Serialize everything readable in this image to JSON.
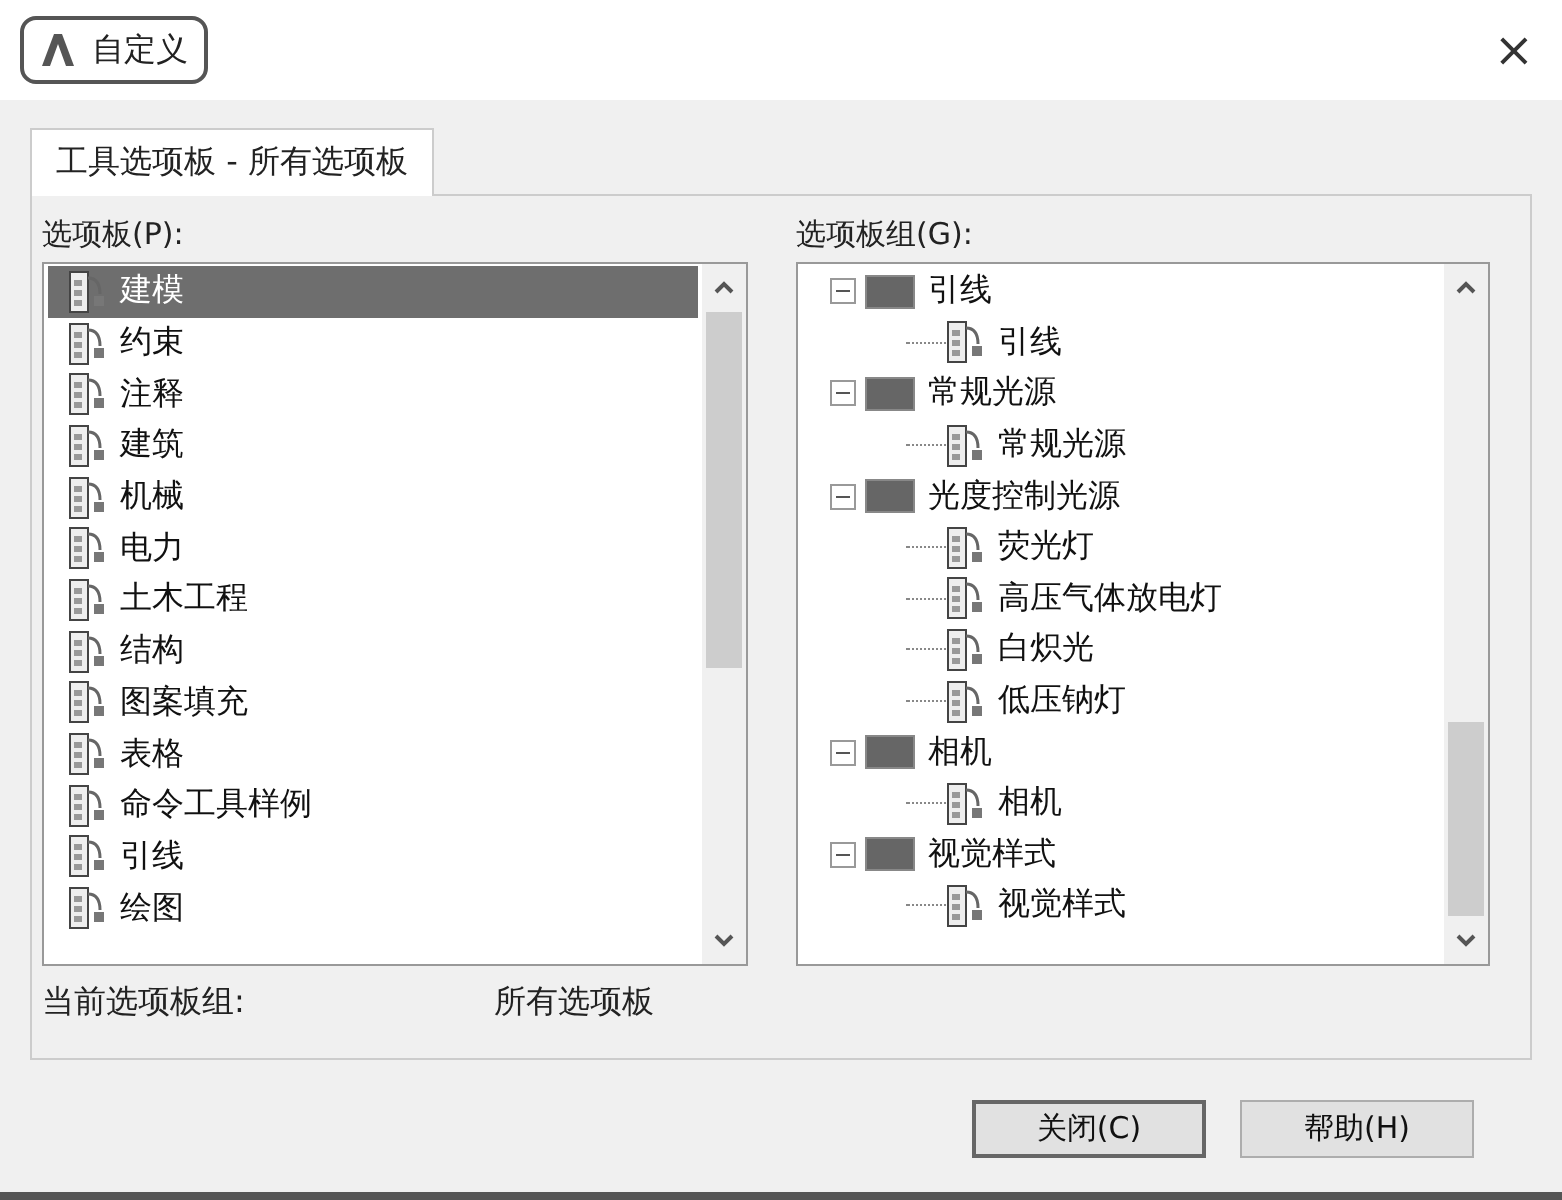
{
  "window": {
    "title": "自定义",
    "close": "×"
  },
  "tabs": [
    {
      "label": "工具选项板 - 所有选项板",
      "selected": true
    }
  ],
  "palettes": {
    "label": "选项板(P):",
    "items": [
      {
        "label": "建模",
        "selected": true
      },
      {
        "label": "约束",
        "selected": false
      },
      {
        "label": "注释",
        "selected": false
      },
      {
        "label": "建筑",
        "selected": false
      },
      {
        "label": "机械",
        "selected": false
      },
      {
        "label": "电力",
        "selected": false
      },
      {
        "label": "土木工程",
        "selected": false
      },
      {
        "label": "结构",
        "selected": false
      },
      {
        "label": "图案填充",
        "selected": false
      },
      {
        "label": "表格",
        "selected": false
      },
      {
        "label": "命令工具样例",
        "selected": false
      },
      {
        "label": "引线",
        "selected": false
      },
      {
        "label": "绘图",
        "selected": false
      }
    ]
  },
  "groups": {
    "label": "选项板组(G):",
    "tree": [
      {
        "label": "引线",
        "expanded": true,
        "children": [
          {
            "label": "引线"
          }
        ]
      },
      {
        "label": "常规光源",
        "expanded": true,
        "children": [
          {
            "label": "常规光源"
          }
        ]
      },
      {
        "label": "光度控制光源",
        "expanded": true,
        "children": [
          {
            "label": "荧光灯"
          },
          {
            "label": "高压气体放电灯"
          },
          {
            "label": "白炽光"
          },
          {
            "label": "低压钠灯"
          }
        ]
      },
      {
        "label": "相机",
        "expanded": true,
        "children": [
          {
            "label": "相机"
          }
        ]
      },
      {
        "label": "视觉样式",
        "expanded": true,
        "children": [
          {
            "label": "视觉样式"
          }
        ]
      }
    ]
  },
  "current_group": {
    "label": "当前选项板组:",
    "value": "所有选项板"
  },
  "buttons": [
    {
      "label": "关闭(C)",
      "default": true
    },
    {
      "label": "帮助(H)",
      "default": false
    }
  ]
}
